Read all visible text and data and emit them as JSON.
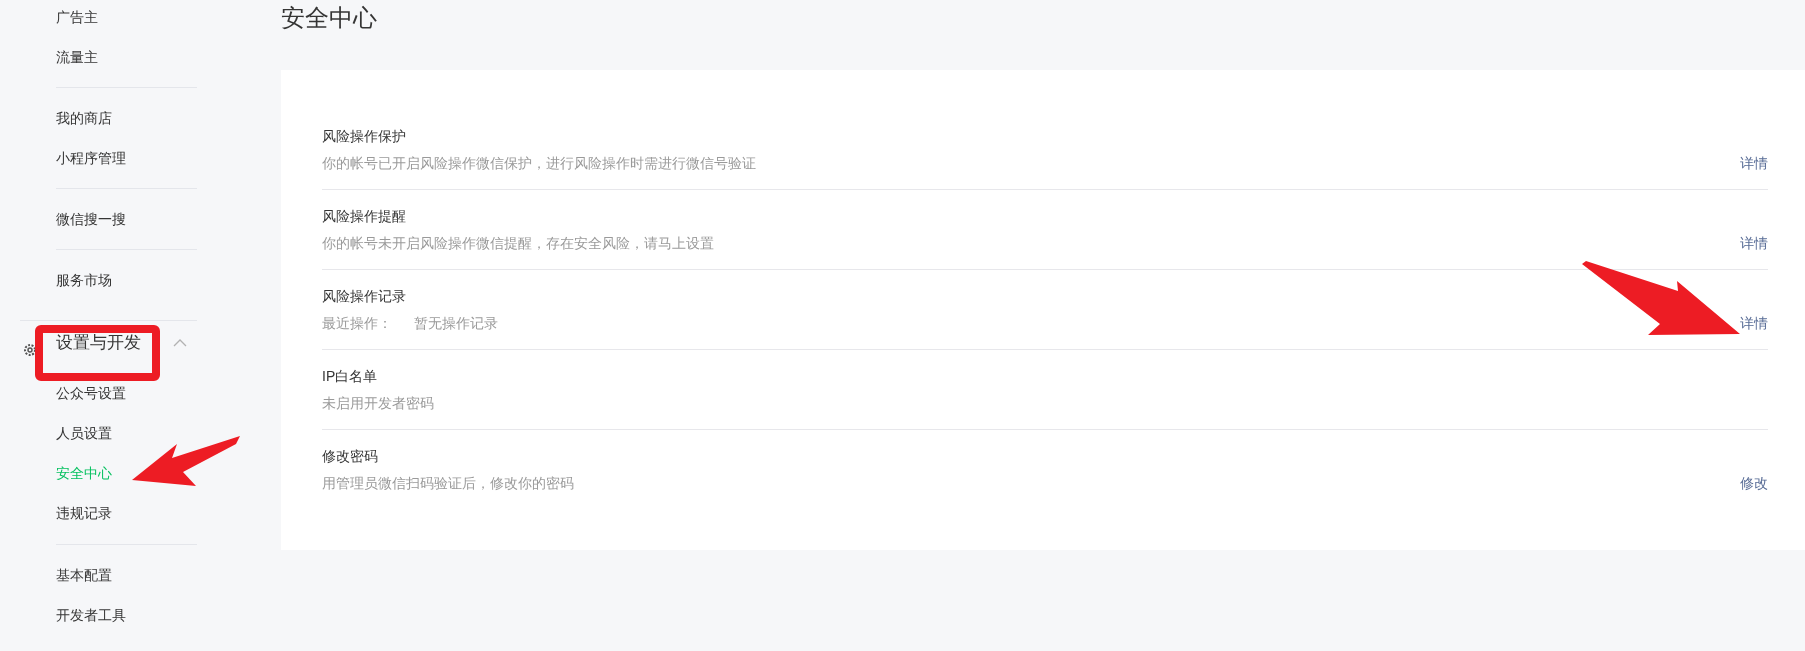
{
  "sidebar": {
    "groups": [
      {
        "items": [
          {
            "label": "广告主",
            "selected": false
          },
          {
            "label": "流量主",
            "selected": false
          }
        ]
      },
      {
        "items": [
          {
            "label": "我的商店",
            "selected": false
          },
          {
            "label": "小程序管理",
            "selected": false
          }
        ]
      },
      {
        "items": [
          {
            "label": "微信搜一搜",
            "selected": false
          }
        ]
      },
      {
        "items": [
          {
            "label": "服务市场",
            "selected": false
          }
        ]
      },
      {
        "header": {
          "label": "设置与开发",
          "expanded": true
        },
        "items": [
          {
            "label": "公众号设置",
            "selected": false
          },
          {
            "label": "人员设置",
            "selected": false
          },
          {
            "label": "安全中心",
            "selected": true
          },
          {
            "label": "违规记录",
            "selected": false
          }
        ]
      },
      {
        "items": [
          {
            "label": "基本配置",
            "selected": false
          },
          {
            "label": "开发者工具",
            "selected": false
          }
        ]
      }
    ]
  },
  "page": {
    "title": "安全中心"
  },
  "settings": [
    {
      "title": "风险操作保护",
      "description": "你的帐号已开启风险操作微信保护，进行风险操作时需进行微信号验证",
      "action": "详情"
    },
    {
      "title": "风险操作提醒",
      "description": "你的帐号未开启风险操作微信提醒，存在安全风险，请马上设置",
      "action": "详情"
    },
    {
      "title": "风险操作记录",
      "description_label": "最近操作：",
      "description": "暂无操作记录",
      "action": "详情"
    },
    {
      "title": "IP白名单",
      "description": "未启用开发者密码"
    },
    {
      "title": "修改密码",
      "description": "用管理员微信扫码验证后，修改你的密码",
      "action": "修改"
    }
  ]
}
